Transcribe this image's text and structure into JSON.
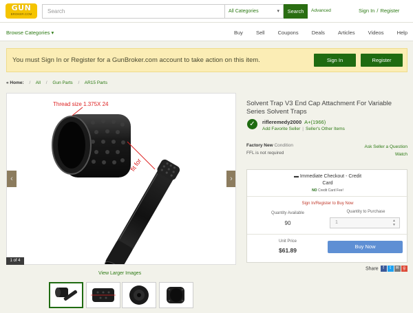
{
  "header": {
    "logo_line1": "GUN",
    "logo_line2": "BROKER.COM",
    "search_placeholder": "Search",
    "category_selected": "All Categories",
    "search_button": "Search",
    "advanced": "Advanced",
    "sign_in": "Sign In",
    "separator": "/",
    "register": "Register"
  },
  "nav": {
    "browse": "Browse Categories",
    "links": [
      "Buy",
      "Sell",
      "Coupons",
      "Deals",
      "Articles",
      "Videos",
      "Help"
    ]
  },
  "banner": {
    "message": "You must Sign In or Register for a GunBroker.com account to take action on this item.",
    "sign_in": "Sign In",
    "register": "Register"
  },
  "breadcrumb": {
    "home": "« Home:",
    "items": [
      "All",
      "Gun Parts",
      "AR15 Parts"
    ]
  },
  "gallery": {
    "annotation_thread": "Thread size  1.375X 24",
    "annotation_fit": "fit for",
    "counter": "1 of 4",
    "view_larger": "View Larger Images",
    "thumbnail_count": 4
  },
  "item": {
    "title": "Solvent Trap V3 End Cap Attachment For Variable Series Solvent Traps",
    "seller_name": "rifleremedy2000",
    "seller_rating": "A+(1966)",
    "add_favorite": "Add Favorite Seller",
    "other_items": "Seller's Other Items",
    "condition_value": "Factory New",
    "condition_label": "Condition",
    "ffl": "FFL is not required",
    "ask_seller": "Ask Seller a Question",
    "watch": "Watch"
  },
  "buybox": {
    "checkout_line1": "Immediate Checkout - Credit",
    "checkout_line2": "Card",
    "no_cc_bold": "NO",
    "no_cc_rest": "Credit Card Fee!",
    "signin_to_buy": "Sign In/Register to Buy Now",
    "qty_available_label": "Quantity Available",
    "qty_available": "90",
    "qty_purchase_label": "Quantity to Purchase",
    "qty_purchase_value": "1",
    "unit_price_label": "Unit Price",
    "unit_price": "$61.89",
    "buy_now": "Buy Now"
  },
  "share": {
    "label": "Share",
    "icons": [
      {
        "name": "facebook-icon",
        "glyph": "f",
        "color": "#3b5998"
      },
      {
        "name": "twitter-icon",
        "glyph": "t",
        "color": "#1da1f2"
      },
      {
        "name": "email-icon",
        "glyph": "✉",
        "color": "#7a7a7a"
      },
      {
        "name": "google-plus-icon",
        "glyph": "g",
        "color": "#dd4b39"
      }
    ]
  },
  "colors": {
    "brand_green": "#1f6b11",
    "link_green": "#2d7a14",
    "logo_yellow": "#f5c400",
    "banner_bg": "#fbedb5",
    "buy_now_blue": "#5e8fd4",
    "alert_red": "#c0392b"
  }
}
